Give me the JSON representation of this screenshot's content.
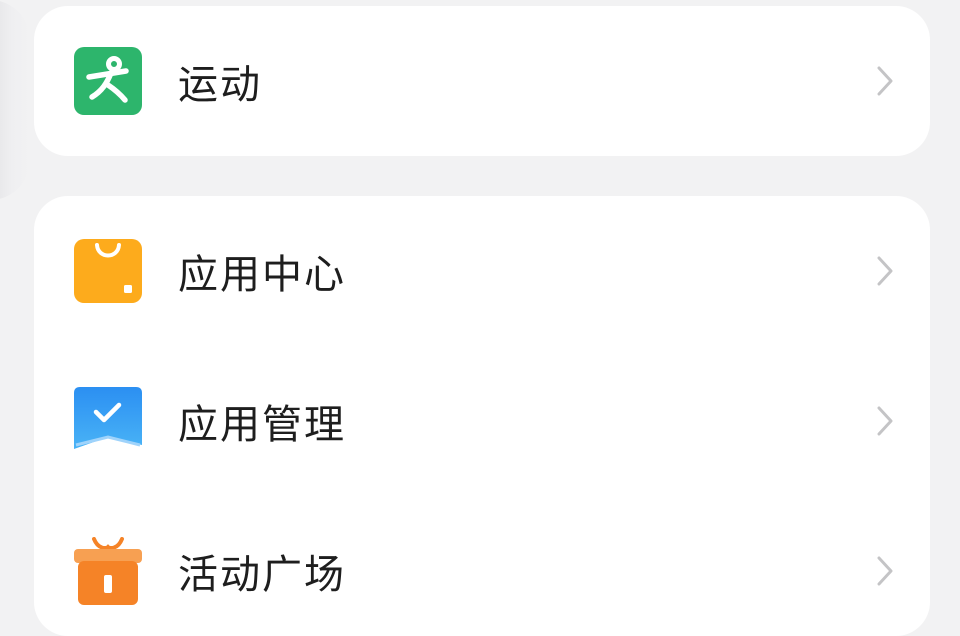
{
  "sport_card": {
    "items": [
      {
        "label": "运动",
        "icon": "running-person-icon",
        "color": "#2db56c"
      }
    ]
  },
  "apps_card": {
    "items": [
      {
        "label": "应用中心",
        "icon": "shopping-bag-icon",
        "color": "#fdab1c"
      },
      {
        "label": "应用管理",
        "icon": "checkmark-envelope-icon",
        "color": "#2f95f3"
      },
      {
        "label": "活动广场",
        "icon": "gift-box-icon",
        "color": "#f58327"
      }
    ]
  }
}
